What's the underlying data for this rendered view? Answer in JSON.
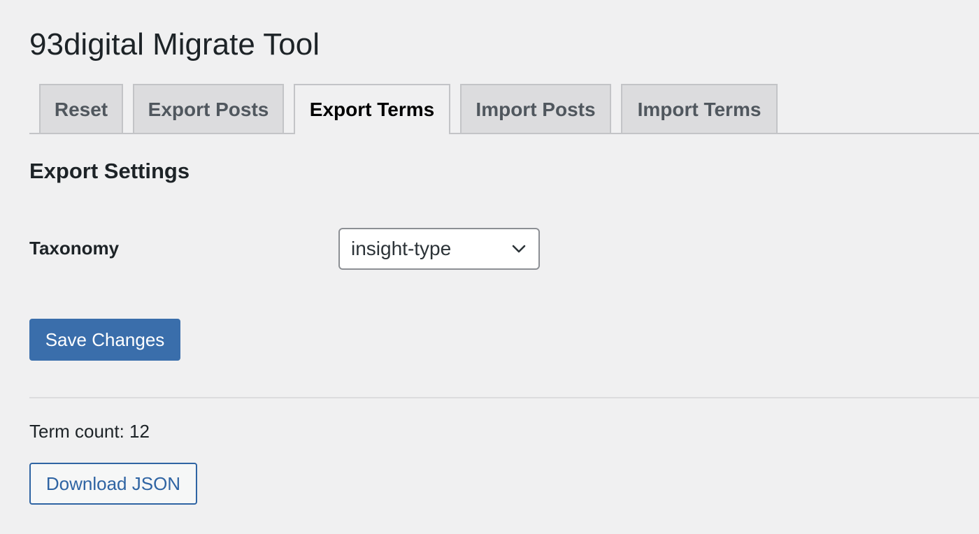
{
  "page": {
    "title": "93digital Migrate Tool"
  },
  "tabs": [
    {
      "label": "Reset",
      "active": false
    },
    {
      "label": "Export Posts",
      "active": false
    },
    {
      "label": "Export Terms",
      "active": true
    },
    {
      "label": "Import Posts",
      "active": false
    },
    {
      "label": "Import Terms",
      "active": false
    }
  ],
  "settings": {
    "heading": "Export Settings",
    "taxonomy_label": "Taxonomy",
    "taxonomy_value": "insight-type",
    "taxonomy_icon": "chevron-down-icon",
    "save_label": "Save Changes"
  },
  "results": {
    "term_count": "Term count: 12",
    "download_label": "Download JSON"
  },
  "colors": {
    "background": "#f0f0f1",
    "primary": "#3a6eab",
    "link": "#2f64a3",
    "tab_inactive_bg": "#dcdcde",
    "border": "#c3c4c7"
  }
}
